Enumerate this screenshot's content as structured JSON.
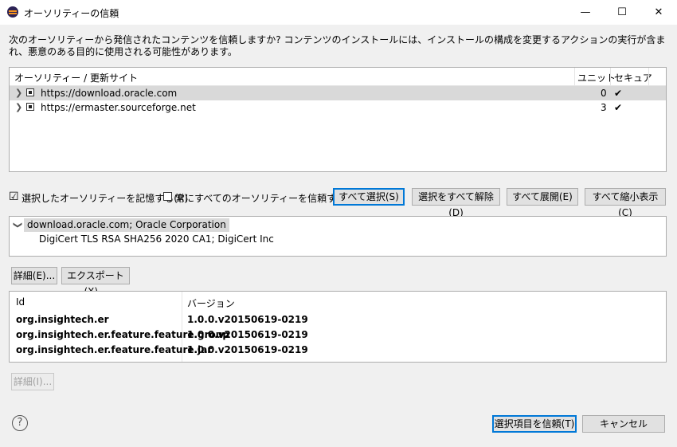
{
  "window": {
    "title": "オーソリティーの信頼",
    "minimize": "—",
    "maximize": "☐",
    "close": "✕"
  },
  "description": "次のオーソリティーから発信されたコンテンツを信頼しますか? コンテンツのインストールには、インストールの構成を変更するアクションの実行が含まれ、悪意のある目的に使用される可能性があります。",
  "authority_table": {
    "headers": {
      "authority": "オーソリティー / 更新サイト",
      "units": "ユニット",
      "secure": "セキュア"
    },
    "rows": [
      {
        "url": "https://download.oracle.com",
        "units": "0",
        "secure": "✔",
        "selected": true
      },
      {
        "url": "https://ermaster.sourceforge.net",
        "units": "3",
        "secure": "✔",
        "selected": false
      }
    ]
  },
  "options": {
    "remember_label": "選択したオーソリティーを記憶する(R)",
    "remember_checked": "☑",
    "always_trust_label": "常にすべてのオーソリティーを信頼する(A)",
    "select_all": "すべて選択(S)",
    "deselect_all": "選択をすべて解除(D)",
    "expand_all": "すべて展開(E)",
    "collapse_all": "すべて縮小表示(C)"
  },
  "cert_tree": {
    "root": "download.oracle.com; Oracle Corporation",
    "child": "DigiCert TLS RSA SHA256 2020 CA1; DigiCert Inc"
  },
  "cert_buttons": {
    "details": "詳細(E)...",
    "export": "エクスポート(X)..."
  },
  "units_table": {
    "headers": {
      "id": "Id",
      "version": "バージョン"
    },
    "rows": [
      {
        "id": "org.insightech.er",
        "version": "1.0.0.v20150619-0219"
      },
      {
        "id": "org.insightech.er.feature.feature.group",
        "version": "1.0.0.v20150619-0219"
      },
      {
        "id": "org.insightech.er.feature.feature.jar",
        "version": "1.0.0.v20150619-0219"
      }
    ]
  },
  "unit_details_button": "詳細(I)...",
  "footer": {
    "help": "?",
    "trust_selected": "選択項目を信頼(T)",
    "cancel": "キャンセル"
  }
}
